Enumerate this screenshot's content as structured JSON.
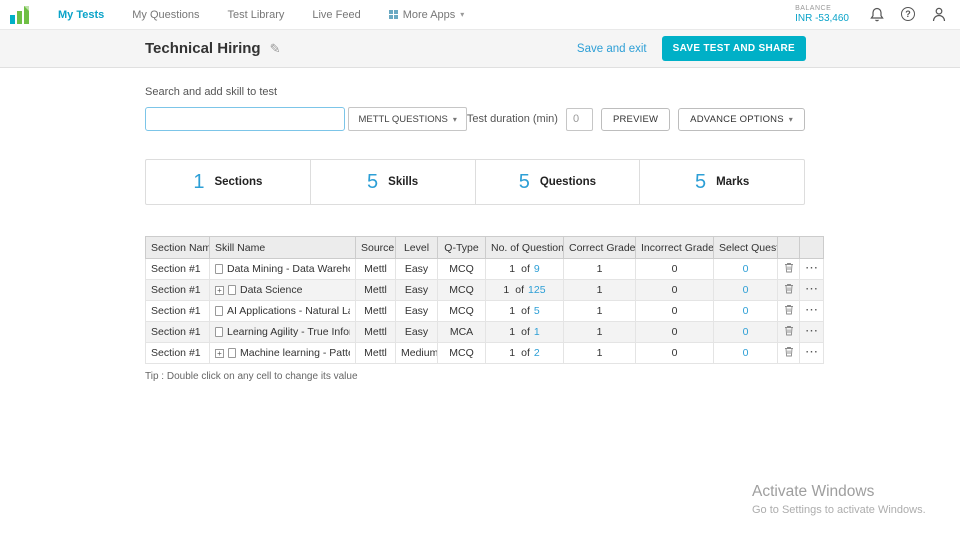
{
  "colors": {
    "accent": "#00b0c7",
    "link_blue": "#2d9fd6",
    "logo_green": "#6fbf44"
  },
  "icons": {
    "chevron_down": "▾",
    "edit_pencil": "✎",
    "help_glyph": "?",
    "expand_plus": "+",
    "ellipsis": "⋯"
  },
  "navbar": {
    "items": [
      {
        "label": "My Tests"
      },
      {
        "label": "My Questions"
      },
      {
        "label": "Test Library"
      },
      {
        "label": "Live Feed"
      },
      {
        "label": "More Apps"
      }
    ],
    "balance_label": "BALANCE",
    "balance_value": "INR -53,460"
  },
  "header": {
    "title": "Technical Hiring",
    "save_and_exit": "Save and exit",
    "save_and_share": "SAVE TEST AND SHARE"
  },
  "toolbar": {
    "search_label": "Search and add skill to test",
    "search_value": "",
    "search_placeholder": "",
    "mettl_questions_button": "METTL QUESTIONS",
    "duration_label": "Test duration (min)",
    "duration_value": "0",
    "preview_button": "PREVIEW",
    "advance_options_button": "ADVANCE OPTIONS"
  },
  "summary_cards": [
    {
      "value": "1",
      "label": "Sections"
    },
    {
      "value": "5",
      "label": "Skills"
    },
    {
      "value": "5",
      "label": "Questions"
    },
    {
      "value": "5",
      "label": "Marks"
    }
  ],
  "table": {
    "headers": {
      "section": "Section Name",
      "skill": "Skill Name",
      "source": "Source",
      "level": "Level",
      "qtype": "Q-Type",
      "questions": "No. of Questions",
      "correct": "Correct Grade",
      "incorrect": "Incorrect Grade",
      "select": "Select Question"
    },
    "of_label": "of",
    "rows": [
      {
        "section": "Section #1",
        "skill": "Data Mining - Data Warehou",
        "source": "Mettl",
        "level": "Easy",
        "qtype": "MCQ",
        "count": "1",
        "total": "9",
        "correct": "1",
        "incorrect": "0",
        "select": "0"
      },
      {
        "section": "Section #1",
        "skill": "Data Science",
        "source": "Mettl",
        "level": "Easy",
        "qtype": "MCQ",
        "count": "1",
        "total": "125",
        "correct": "1",
        "incorrect": "0",
        "select": "0"
      },
      {
        "section": "Section #1",
        "skill": "AI Applications - Natural Lan",
        "source": "Mettl",
        "level": "Easy",
        "qtype": "MCQ",
        "count": "1",
        "total": "5",
        "correct": "1",
        "incorrect": "0",
        "select": "0"
      },
      {
        "section": "Section #1",
        "skill": "Learning Agility - True Infor",
        "source": "Mettl",
        "level": "Easy",
        "qtype": "MCA",
        "count": "1",
        "total": "1",
        "correct": "1",
        "incorrect": "0",
        "select": "0"
      },
      {
        "section": "Section #1",
        "skill": "Machine learning - Pattern R",
        "source": "Mettl",
        "level": "Medium",
        "qtype": "MCQ",
        "count": "1",
        "total": "2",
        "correct": "1",
        "incorrect": "0",
        "select": "0"
      }
    ],
    "tip": "Tip : Double click on any cell to change its value"
  },
  "watermark": {
    "title": "Activate Windows",
    "subtitle": "Go to Settings to activate Windows."
  }
}
